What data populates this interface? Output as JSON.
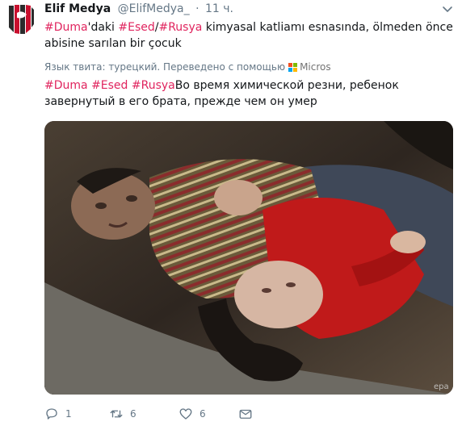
{
  "tweet": {
    "author_name": "Elif Medya",
    "author_handle": "@ElifMedya_",
    "separator": "·",
    "time": "11 ч.",
    "text_parts": [
      {
        "text": "#Duma",
        "tag": true
      },
      {
        "text": "'daki ",
        "tag": false
      },
      {
        "text": "#Esed",
        "tag": true
      },
      {
        "text": "/",
        "tag": false
      },
      {
        "text": "#Rusya",
        "tag": true
      },
      {
        "text": " kimyasal katliamı esnasında, ölmeden önce abisine sarılan bir çocuk",
        "tag": false
      }
    ]
  },
  "translation": {
    "note": "Язык твита: турецкий. Переведено с помощью",
    "brand": "Micros",
    "text_parts": [
      {
        "text": "#Duma",
        "tag": true
      },
      {
        "text": " ",
        "tag": false
      },
      {
        "text": "#Esed",
        "tag": true
      },
      {
        "text": " ",
        "tag": false
      },
      {
        "text": "#Rusya",
        "tag": true
      },
      {
        "text": "Во время химической резни, ребенок завернутый в его брата, прежде чем он умер",
        "tag": false
      }
    ]
  },
  "media": {
    "watermark": "epa"
  },
  "actions": {
    "reply_count": "1",
    "retweet_count": "6",
    "like_count": "6"
  },
  "colors": {
    "hashtag": "#e0245e",
    "muted": "#657786",
    "text": "#14171a",
    "ms_red": "#f25022",
    "ms_green": "#7fba00",
    "ms_blue": "#00a4ef",
    "ms_yellow": "#ffb900"
  },
  "icons": [
    "avatar-logo-icon",
    "chevron-down-icon",
    "microsoft-logo-icon",
    "reply-icon",
    "retweet-icon",
    "like-icon",
    "direct-message-icon"
  ]
}
